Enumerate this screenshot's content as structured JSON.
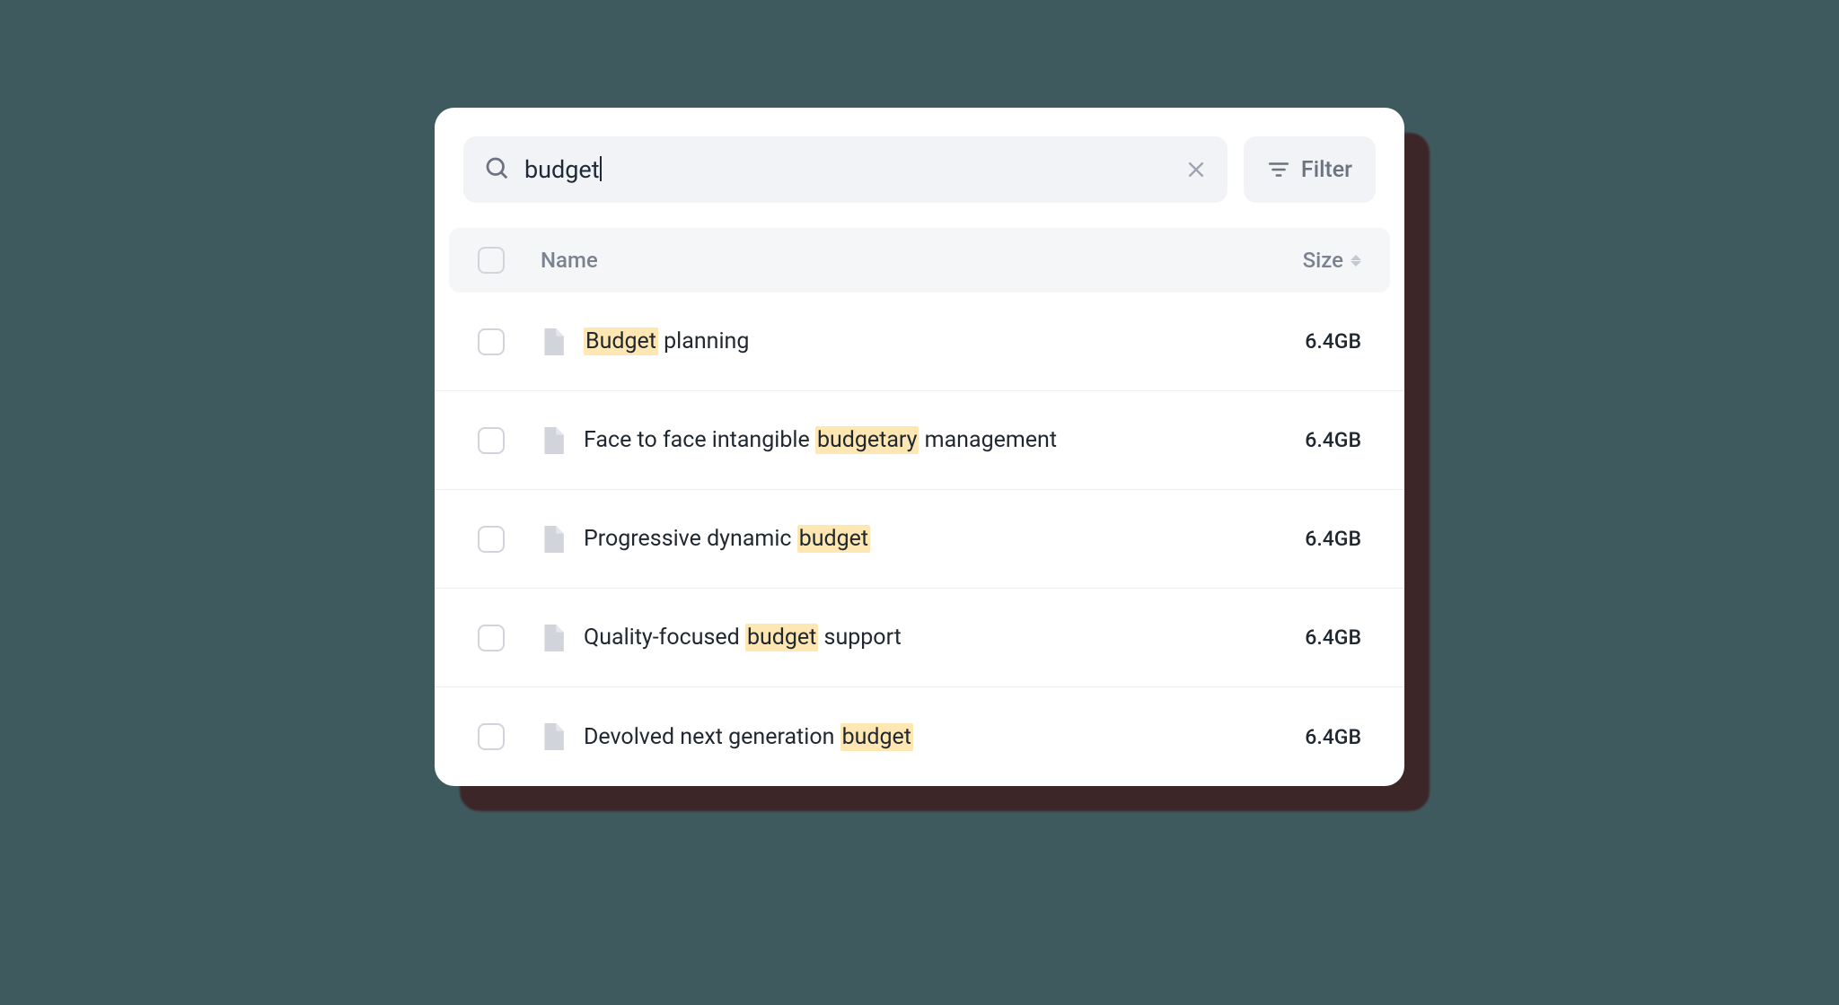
{
  "search": {
    "value": "budget",
    "placeholder": ""
  },
  "filter": {
    "label": "Filter"
  },
  "columns": {
    "name": "Name",
    "size": "Size"
  },
  "rows": [
    {
      "name": "Budget planning",
      "highlight": "Budget",
      "size": "6.4GB"
    },
    {
      "name": "Face to face intangible budgetary management",
      "highlight": "budgetary",
      "size": "6.4GB"
    },
    {
      "name": "Progressive dynamic budget",
      "highlight": "budget",
      "size": "6.4GB"
    },
    {
      "name": "Quality-focused budget support",
      "highlight": "budget",
      "size": "6.4GB"
    },
    {
      "name": "Devolved next generation budget",
      "highlight": "budget",
      "size": "6.4GB"
    }
  ],
  "colors": {
    "highlight": "#ffe7b3",
    "panel_bg": "#ffffff",
    "page_bg": "#3f5a5f",
    "muted": "#6b7280"
  }
}
